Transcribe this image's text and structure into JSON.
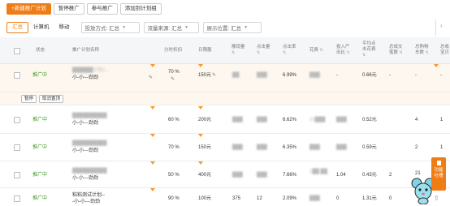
{
  "toolbar": {
    "new_plan": "+新建推广计划",
    "pause": "暂停推广",
    "join": "参与推广",
    "add_to_group": "添加到计划组"
  },
  "filters": {
    "tabs": [
      "汇总",
      "计算机",
      "移动"
    ],
    "active_tab": "汇总",
    "bid_mode": "投放方式: 汇总",
    "traffic_source": "流量来源: 汇总",
    "display_position": "展示位置: 汇总"
  },
  "table": {
    "headers": {
      "status": "状态",
      "plan_name": "推广计划名称",
      "time_discount": "分时折扣",
      "daily_budget": "日限额",
      "impressions": "展现量",
      "clicks": "点击量",
      "ctr": "点击率",
      "cost": "花费",
      "roi_line1": "投入产",
      "roi_line2": "出比",
      "avg_cpc_line1": "平均点",
      "avg_cpc_line2": "击花费",
      "total_deals_line1": "总成交",
      "total_deals_line2": "笔数",
      "total_fav_line1": "总购物",
      "total_fav_line2": "车数",
      "extra_line1": "总收",
      "extra_line2": "宝贝"
    },
    "rows": [
      {
        "status": "推广中",
        "name_line1": "██████计划1...",
        "name_line2": "小-小---劲劲",
        "discount": "70 %",
        "budget": "150元",
        "impressions": "██",
        "clicks": "███",
        "ctr": "6.99%",
        "cost": "███",
        "roi": "-",
        "cpc": "0.66元",
        "deals": "-",
        "fav": "-",
        "extra": "-"
      },
      {
        "status": "推广中",
        "name_line1": "██████████",
        "name_line2": "小-小---劲劲",
        "discount": "60 %",
        "budget": "200元",
        "impressions": "███",
        "clicks": "███",
        "ctr": "6.62%",
        "cost": "31███",
        "roi": "███",
        "cpc": "0.52元",
        "deals": "",
        "fav": "4",
        "extra": "1"
      },
      {
        "status": "推广中",
        "name_line1": "██████████",
        "name_line2": "小-小---劲劲",
        "discount": "70 %",
        "budget": "150元",
        "impressions": "███",
        "clicks": "███",
        "ctr": "6.35%",
        "cost": "███",
        "roi": "███",
        "cpc": "0.59元",
        "deals": "",
        "fav": "2",
        "extra": "1"
      },
      {
        "status": "推广中",
        "name_line1": "██████████",
        "name_line2": "小-小---劲劲",
        "discount": "50 %",
        "budget": "400元",
        "impressions": "███",
        "clicks": "███",
        "ctr": "7.66%",
        "cost": "1██.██",
        "roi": "1.04",
        "cpc": "0.43元",
        "deals": "2",
        "fav": "21",
        "extra": ""
      },
      {
        "status": "推广中",
        "name_line1": "粘粘测试计划--",
        "name_line2": "-小-小---劲劲",
        "discount": "90 %",
        "budget": "100元",
        "impressions": "375",
        "clicks": "12",
        "ctr": "2.09%",
        "cost": "███",
        "roi": "0",
        "cpc": "1.31元",
        "deals": "0",
        "fav": "",
        "extra": ""
      }
    ],
    "row_actions": {
      "pause": "暂停",
      "unpin": "取消置顶"
    }
  },
  "side": {
    "feedback_line1": "功能",
    "feedback_line2": "吐槽",
    "to_top": "⇧"
  },
  "colors": {
    "accent": "#f07c16",
    "status_green": "#3a9a1f"
  },
  "icons": [
    "pencil-icon",
    "sort-icon",
    "chevron-down-icon",
    "checkbox",
    "mascot-mouse"
  ]
}
